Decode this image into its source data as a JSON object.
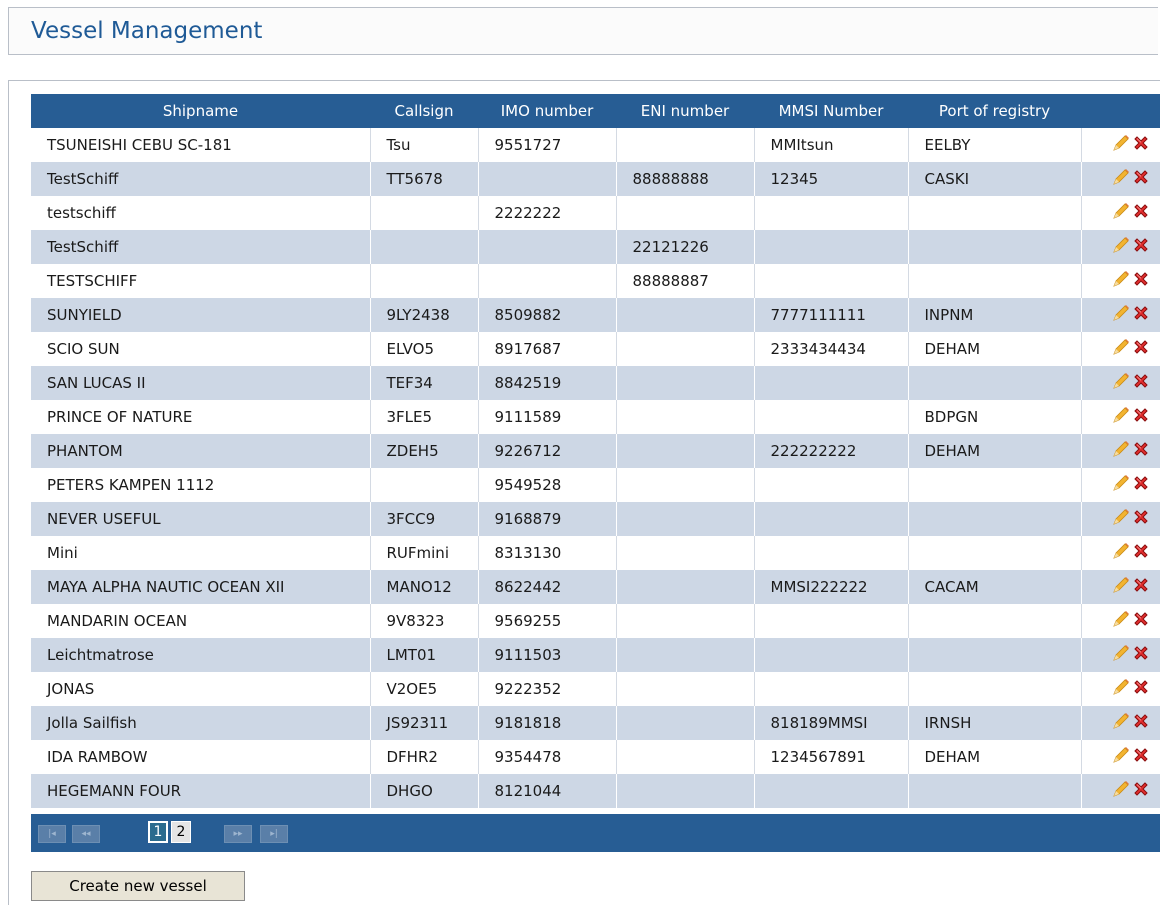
{
  "page": {
    "title": "Vessel Management"
  },
  "table": {
    "columns": [
      "Shipname",
      "Callsign",
      "IMO number",
      "ENI number",
      "MMSI Number",
      "Port of registry",
      ""
    ],
    "rows": [
      [
        "TSUNEISHI CEBU SC-181",
        "Tsu",
        "9551727",
        "",
        "MMItsun",
        "EELBY"
      ],
      [
        "TestSchiff",
        "TT5678",
        "",
        "88888888",
        "12345",
        "CASKI"
      ],
      [
        "testschiff",
        "",
        "2222222",
        "",
        "",
        ""
      ],
      [
        "TestSchiff",
        "",
        "",
        "22121226",
        "",
        ""
      ],
      [
        "TESTSCHIFF",
        "",
        "",
        "88888887",
        "",
        ""
      ],
      [
        "SUNYIELD",
        "9LY2438",
        "8509882",
        "",
        "7777111111",
        "INPNM"
      ],
      [
        "SCIO SUN",
        "ELVO5",
        "8917687",
        "",
        "2333434434",
        "DEHAM"
      ],
      [
        "SAN LUCAS II",
        "TEF34",
        "8842519",
        "",
        "",
        ""
      ],
      [
        "PRINCE OF NATURE",
        "3FLE5",
        "9111589",
        "",
        "",
        "BDPGN"
      ],
      [
        "PHANTOM",
        "ZDEH5",
        "9226712",
        "",
        "222222222",
        "DEHAM"
      ],
      [
        "PETERS KAMPEN 1112",
        "",
        "9549528",
        "",
        "",
        ""
      ],
      [
        "NEVER USEFUL",
        "3FCC9",
        "9168879",
        "",
        "",
        ""
      ],
      [
        "Mini",
        "RUFmini",
        "8313130",
        "",
        "",
        ""
      ],
      [
        "MAYA ALPHA NAUTIC OCEAN XII",
        "MANO12",
        "8622442",
        "",
        "MMSI222222",
        "CACAM"
      ],
      [
        "MANDARIN OCEAN",
        "9V8323",
        "9569255",
        "",
        "",
        ""
      ],
      [
        "Leichtmatrose",
        "LMT01",
        "9111503",
        "",
        "",
        ""
      ],
      [
        "JONAS",
        "V2OE5",
        "9222352",
        "",
        "",
        ""
      ],
      [
        "Jolla Sailfish",
        "JS92311",
        "9181818",
        "",
        "818189MMSI",
        "IRNSH"
      ],
      [
        "IDA RAMBOW",
        "DFHR2",
        "9354478",
        "",
        "1234567891",
        "DEHAM"
      ],
      [
        "HEGEMANN FOUR",
        "DHGO",
        "8121044",
        "",
        "",
        ""
      ]
    ]
  },
  "pager": {
    "pages": [
      "1",
      "2"
    ],
    "current_page": "1",
    "first_icon": "first-page-icon",
    "prev_icon": "prev-page-icon",
    "next_icon": "next-page-icon",
    "last_icon": "last-page-icon"
  },
  "actions": {
    "create_label": "Create new vessel",
    "edit_icon": "pencil-icon",
    "delete_icon": "red-x-icon"
  },
  "colors": {
    "header_bg": "#275d94",
    "title_text": "#1f5a96",
    "row_alt": "#cdd7e5"
  }
}
